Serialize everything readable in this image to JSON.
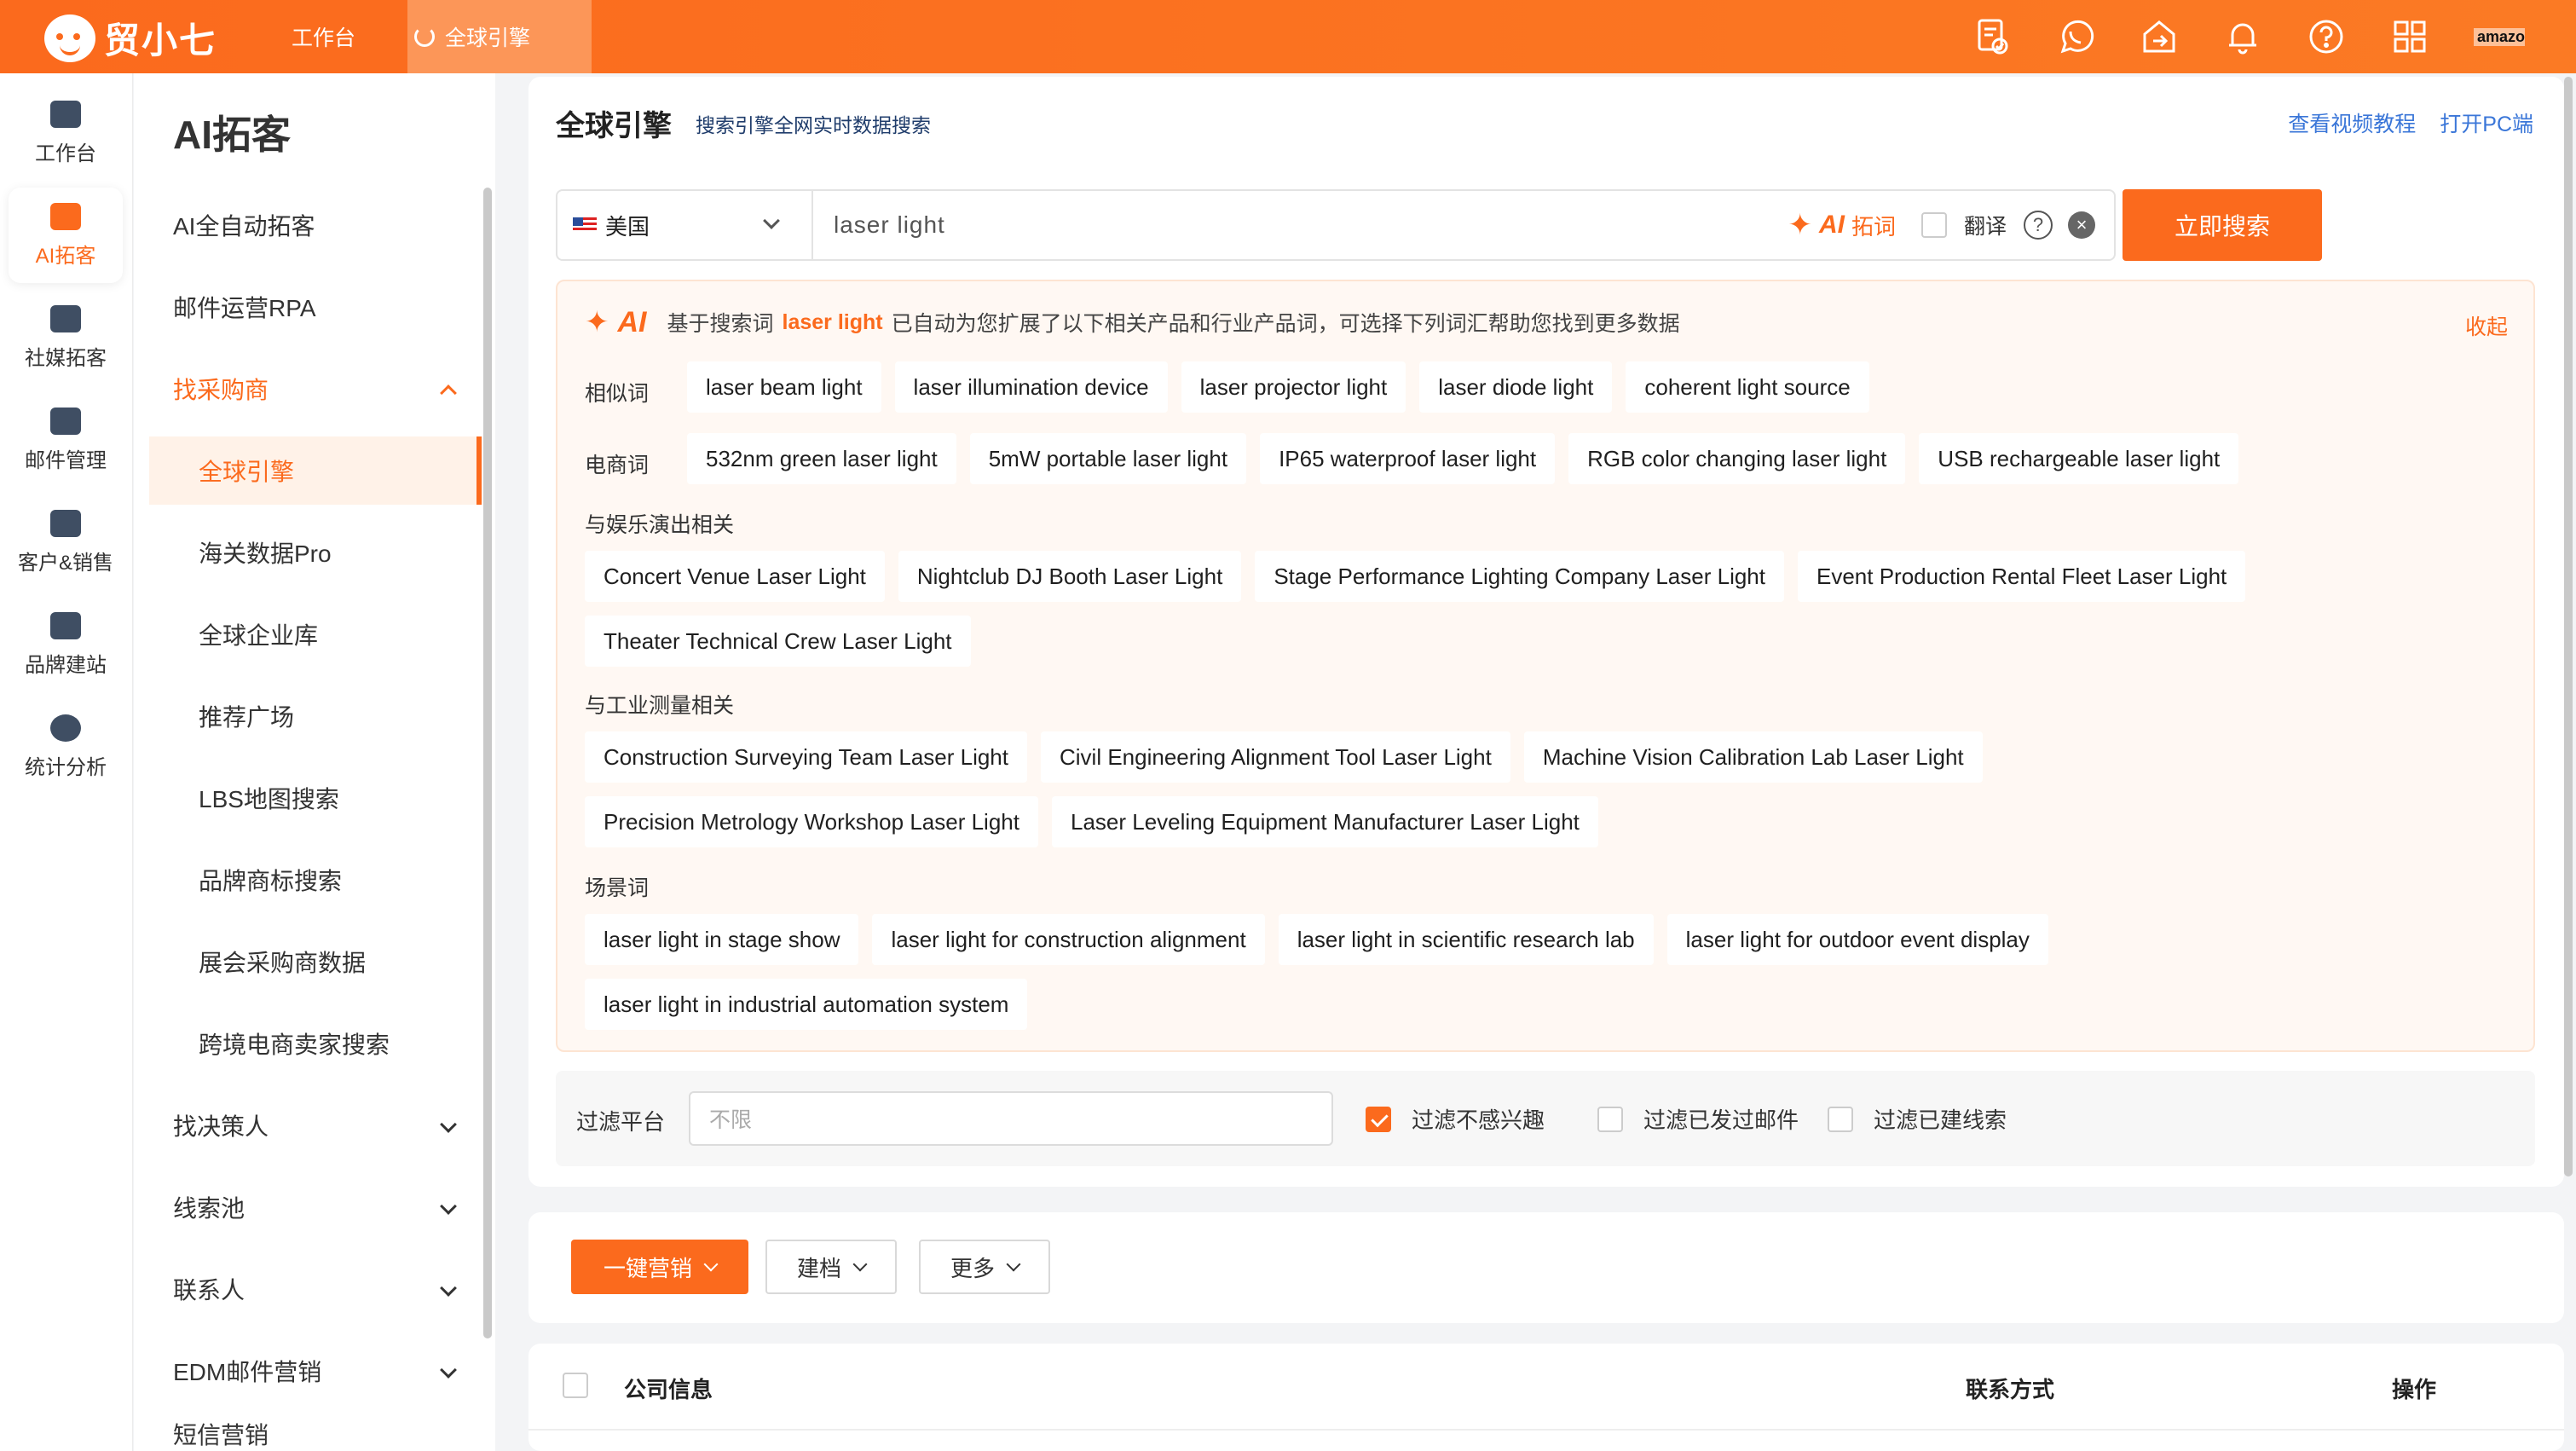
{
  "app": {
    "name": "贸小七",
    "tabs": [
      "工作台",
      "全球引擎"
    ],
    "top_icons": [
      "document-check-icon",
      "whatsapp-icon",
      "share-icon",
      "bell-icon",
      "help-icon",
      "apps-grid-icon"
    ],
    "amazon_label": "amazon"
  },
  "rail": [
    {
      "label": "工作台",
      "icon": "monitor-icon"
    },
    {
      "label": "AI拓客",
      "icon": "robot-icon",
      "active": true
    },
    {
      "label": "社媒拓客",
      "icon": "users-icon"
    },
    {
      "label": "邮件管理",
      "icon": "mail-icon"
    },
    {
      "label": "客户&销售",
      "icon": "person-icon"
    },
    {
      "label": "品牌建站",
      "icon": "chart-line-icon"
    },
    {
      "label": "统计分析",
      "icon": "pie-chart-icon"
    }
  ],
  "menu": {
    "title": "AI拓客",
    "items": [
      {
        "label": "AI全自动拓客"
      },
      {
        "label": "邮件运营RPA"
      },
      {
        "label": "找采购商",
        "open": true
      },
      {
        "label": "全球引擎",
        "active": true
      },
      {
        "label": "海关数据Pro"
      },
      {
        "label": "全球企业库"
      },
      {
        "label": "推荐广场"
      },
      {
        "label": "LBS地图搜索"
      },
      {
        "label": "品牌商标搜索"
      },
      {
        "label": "展会采购商数据"
      },
      {
        "label": "跨境电商卖家搜索"
      },
      {
        "label": "找决策人"
      },
      {
        "label": "线索池"
      },
      {
        "label": "联系人"
      },
      {
        "label": "EDM邮件营销"
      },
      {
        "label": "短信营销"
      }
    ]
  },
  "page": {
    "title": "全球引擎",
    "subtitle": "搜索引擎全网实时数据搜索",
    "links": [
      "查看视频教程",
      "打开PC端"
    ]
  },
  "search": {
    "country": "美国",
    "query": "laser light",
    "ai_label": "AI",
    "ai_suffix": "拓词",
    "translate_label": "翻译",
    "button": "立即搜索"
  },
  "ai_panel": {
    "ai_word": "AI",
    "prefix": "基于搜索词",
    "keyword": "laser light",
    "suffix": "已自动为您扩展了以下相关产品和行业产品词，可选择下列词汇帮助您找到更多数据",
    "collapse": "收起",
    "similar_label": "相似词",
    "similar": [
      "laser beam light",
      "laser illumination device",
      "laser projector light",
      "laser diode light",
      "coherent light source"
    ],
    "ecommerce_label": "电商词",
    "ecommerce": [
      "532nm green laser light",
      "5mW portable laser light",
      "IP65 waterproof laser light",
      "RGB color changing laser light",
      "USB rechargeable laser light"
    ],
    "entertainment_label": "与娱乐演出相关",
    "entertainment_row1": [
      "Concert Venue Laser Light",
      "Nightclub DJ Booth Laser Light",
      "Stage Performance Lighting Company Laser Light",
      "Event Production Rental Fleet Laser Light"
    ],
    "entertainment_row2": [
      "Theater Technical Crew Laser Light"
    ],
    "industrial_label": "与工业测量相关",
    "industrial_row1": [
      "Construction Surveying Team Laser Light",
      "Civil Engineering Alignment Tool Laser Light",
      "Machine Vision Calibration Lab Laser Light"
    ],
    "industrial_row2": [
      "Precision Metrology Workshop Laser Light",
      "Laser Leveling Equipment Manufacturer Laser Light"
    ],
    "scene_label": "场景词",
    "scene_row1": [
      "laser light in stage show",
      "laser light for construction alignment",
      "laser light in scientific research lab",
      "laser light for outdoor event display"
    ],
    "scene_row2": [
      "laser light in industrial automation system"
    ]
  },
  "filter": {
    "label": "过滤平台",
    "placeholder": "不限",
    "options": [
      {
        "label": "过滤不感兴趣",
        "checked": true
      },
      {
        "label": "过滤已发过邮件",
        "checked": false
      },
      {
        "label": "过滤已建线索",
        "checked": false
      }
    ]
  },
  "actions": {
    "marketing": "一键营销",
    "archive": "建档",
    "more": "更多"
  },
  "table": {
    "columns": [
      "公司信息",
      "联系方式",
      "操作"
    ]
  },
  "colors": {
    "accent": "#fb6a1d",
    "link": "#3a76d8"
  }
}
